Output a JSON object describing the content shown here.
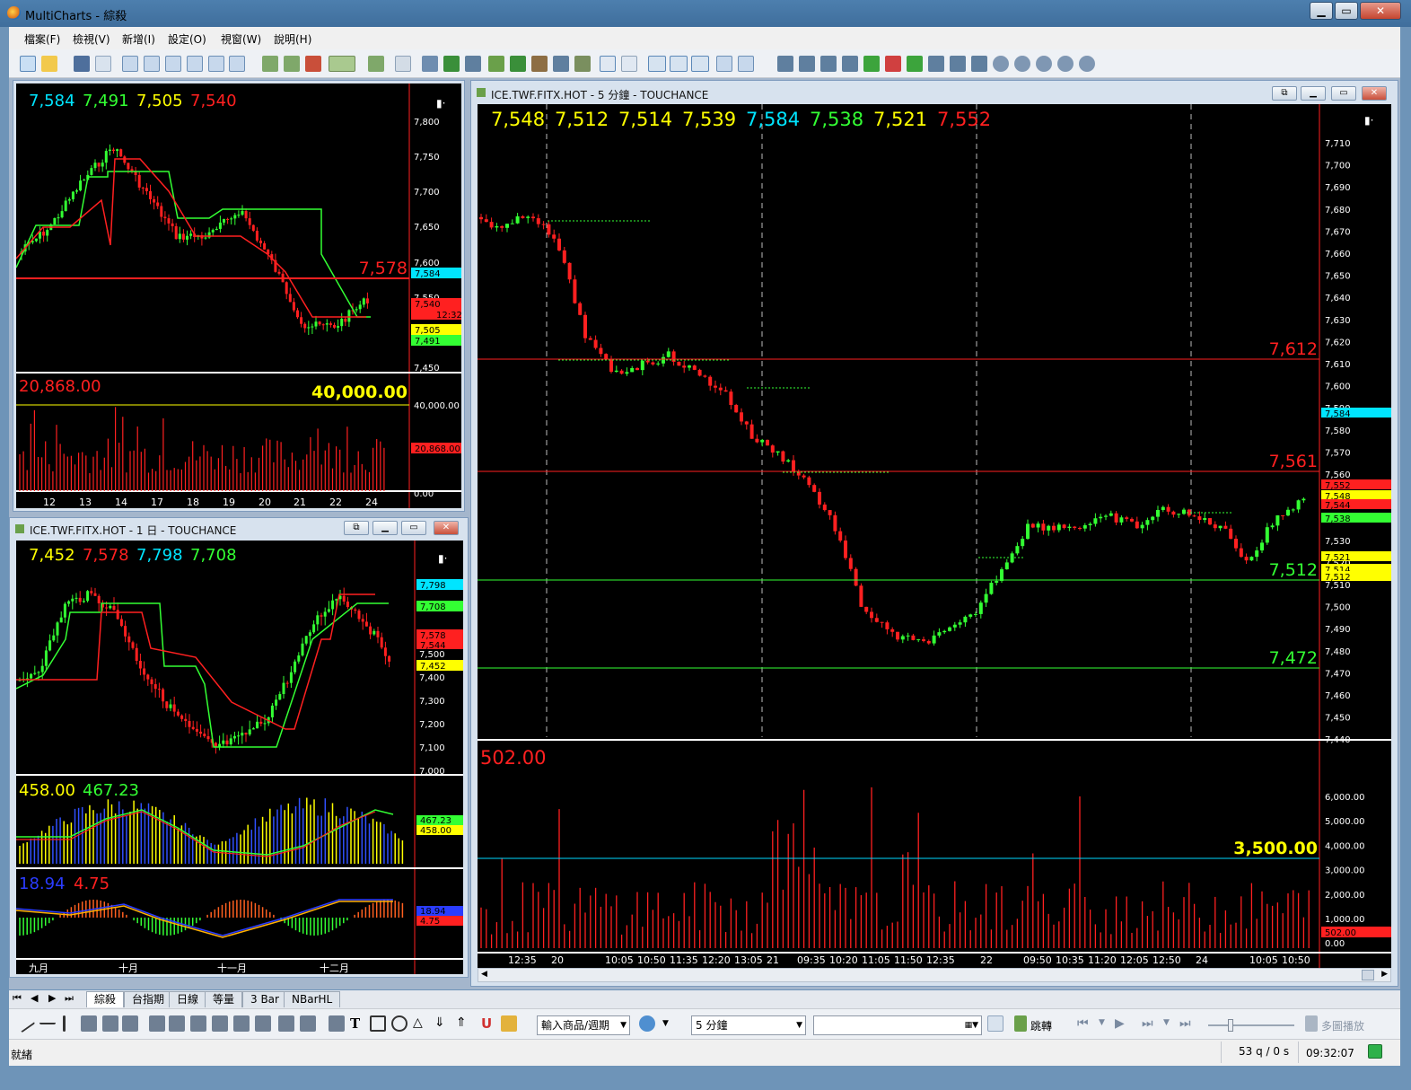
{
  "app": {
    "title": "MultiCharts - 綜殺",
    "min": "▁",
    "max": "▭",
    "close": "✕"
  },
  "menu": [
    "檔案(F)",
    "檢視(V)",
    "新增(I)",
    "設定(O)",
    "視窗(W)",
    "說明(H)"
  ],
  "windows": {
    "w1": {
      "header_values": [
        {
          "v": "7,584",
          "c": "#00e5ff"
        },
        {
          "v": "7,491",
          "c": "#33ff33"
        },
        {
          "v": "7,505",
          "c": "#ffff00"
        },
        {
          "v": "7,540",
          "c": "#ff2020"
        }
      ],
      "price_ticks": [
        "7,800",
        "7,750",
        "7,700",
        "7,650",
        "7,600",
        "7,550",
        "7,450"
      ],
      "hline_label": "7,578",
      "tags": [
        {
          "v": "7,584",
          "c": "#00e5ff"
        },
        {
          "v": "7,540",
          "c": "#ff2020"
        },
        {
          "v": "12:32",
          "c": "#ff2020"
        },
        {
          "v": "7,505",
          "c": "#ffff00"
        },
        {
          "v": "7,491",
          "c": "#33ff33"
        }
      ],
      "vol_left": "20,868.00",
      "vol_right": "40,000.00",
      "vol_ticks": [
        "40,000.00",
        "0.00"
      ],
      "vol_tag": "20,868.00",
      "x_labels": [
        "12",
        "13",
        "14",
        "17",
        "18",
        "19",
        "20",
        "21",
        "22",
        "24"
      ]
    },
    "w2": {
      "title": "ICE.TWF.FITX.HOT - 1 日 - TOUCHANCE",
      "header_values": [
        {
          "v": "7,452",
          "c": "#ffff00"
        },
        {
          "v": "7,578",
          "c": "#ff2020"
        },
        {
          "v": "7,798",
          "c": "#00e5ff"
        },
        {
          "v": "7,708",
          "c": "#33ff33"
        }
      ],
      "price_ticks": [
        "7,500",
        "7,400",
        "7,300",
        "7,200",
        "7,100",
        "7,000"
      ],
      "tags": [
        {
          "v": "7,798",
          "c": "#00e5ff"
        },
        {
          "v": "7,708",
          "c": "#33ff33"
        },
        {
          "v": "7,578",
          "c": "#ff2020"
        },
        {
          "v": "7,544",
          "c": "#ff2020"
        },
        {
          "v": "7,452",
          "c": "#ffff00"
        }
      ],
      "ind1_values": [
        {
          "v": "458.00",
          "c": "#ffff00"
        },
        {
          "v": "467.23",
          "c": "#33ff33"
        }
      ],
      "ind1_tags": [
        {
          "v": "467.23",
          "c": "#33ff33"
        },
        {
          "v": "458.00",
          "c": "#ffff00"
        }
      ],
      "ind2_values": [
        {
          "v": "18.94",
          "c": "#2a3cff"
        },
        {
          "v": "4.75",
          "c": "#ff2020"
        }
      ],
      "ind2_tags": [
        {
          "v": "18.94",
          "c": "#2a3cff"
        },
        {
          "v": "4.75",
          "c": "#ff2020"
        }
      ],
      "x_labels": [
        "九月",
        "十月",
        "十一月",
        "十二月"
      ]
    },
    "w3": {
      "title": "ICE.TWF.FITX.HOT - 5 分鐘 - TOUCHANCE",
      "header_values": [
        {
          "v": "7,548",
          "c": "#ffff00"
        },
        {
          "v": "7,512",
          "c": "#ffff00"
        },
        {
          "v": "7,514",
          "c": "#ffff00"
        },
        {
          "v": "7,539",
          "c": "#ffff00"
        },
        {
          "v": "7,584",
          "c": "#00e5ff"
        },
        {
          "v": "7,538",
          "c": "#33ff33"
        },
        {
          "v": "7,521",
          "c": "#ffff00"
        },
        {
          "v": "7,552",
          "c": "#ff2020"
        }
      ],
      "price_ticks": [
        "7,710",
        "7,700",
        "7,690",
        "7,680",
        "7,670",
        "7,660",
        "7,650",
        "7,640",
        "7,630",
        "7,620",
        "7,610",
        "7,600",
        "7,590",
        "7,580",
        "7,570",
        "7,560",
        "7,550",
        "7,540",
        "7,530",
        "7,520",
        "7,510",
        "7,500",
        "7,490",
        "7,480",
        "7,470",
        "7,460",
        "7,450",
        "7,440"
      ],
      "levels": [
        {
          "v": "7,612",
          "c": "#ff2020"
        },
        {
          "v": "7,561",
          "c": "#ff2020"
        },
        {
          "v": "7,512",
          "c": "#33ff33"
        },
        {
          "v": "7,472",
          "c": "#33ff33"
        }
      ],
      "tags": [
        {
          "v": "7,584",
          "c": "#00e5ff"
        },
        {
          "v": "7,552",
          "c": "#ff2020"
        },
        {
          "v": "7,548",
          "c": "#ffff00"
        },
        {
          "v": "7,544",
          "c": "#ff2020"
        },
        {
          "v": "7,538",
          "c": "#33ff33"
        },
        {
          "v": "7,521",
          "c": "#ffff00"
        },
        {
          "v": "7,514",
          "c": "#ffff00"
        },
        {
          "v": "7,512",
          "c": "#ffff00"
        }
      ],
      "vol_left": "502.00",
      "vol_line": "3,500.00",
      "vol_ticks": [
        "6,000.00",
        "5,000.00",
        "4,000.00",
        "3,000.00",
        "2,000.00",
        "1,000.00",
        "0.00"
      ],
      "vol_tag": "502.00",
      "x_labels": [
        "12:35",
        "20",
        "10:05",
        "10:50",
        "11:35",
        "12:20",
        "13:05",
        "21",
        "09:35",
        "10:20",
        "11:05",
        "11:50",
        "12:35",
        "22",
        "09:50",
        "10:35",
        "11:20",
        "12:05",
        "12:50",
        "24",
        "10:05",
        "10:50"
      ]
    }
  },
  "tabs": [
    "綜殺",
    "台指期",
    "日線",
    "等量",
    "3 Bar",
    "NBarHL"
  ],
  "drawbar": {
    "symbol_label": "輸入商品/週期",
    "interval": "5 分鐘",
    "jump": "跳轉",
    "multi": "多圖播放"
  },
  "status": {
    "left": "就緒",
    "queue": "53 q / 0 s",
    "time": "09:32:07"
  }
}
